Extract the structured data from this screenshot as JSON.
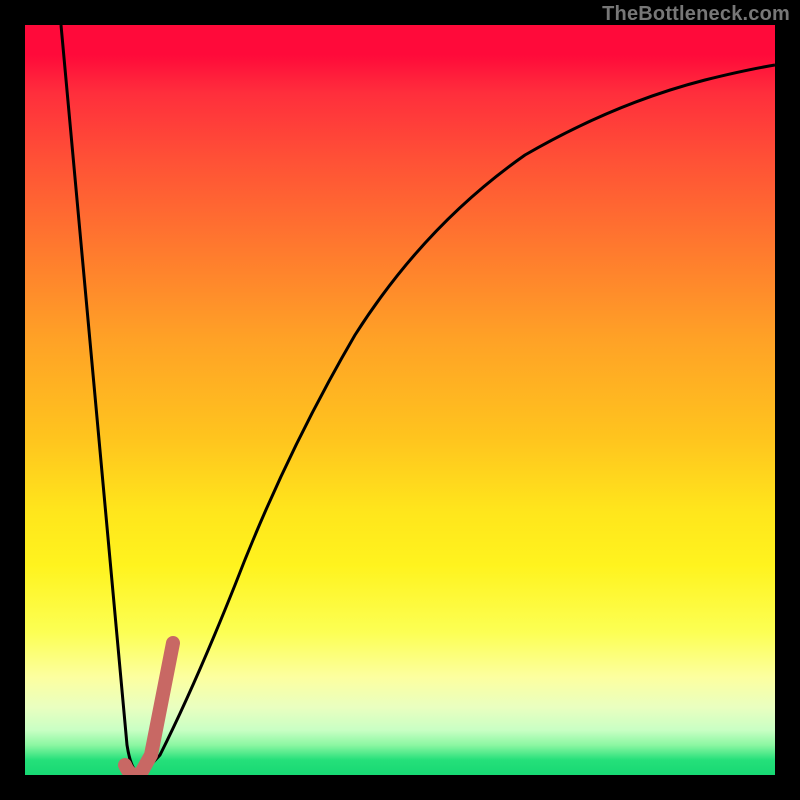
{
  "watermark": "TheBottleneck.com",
  "colors": {
    "frame": "#000000",
    "curve": "#000000",
    "overlay": "#c86864",
    "gradient_top": "#ff0a3a",
    "gradient_bottom": "#17d873"
  },
  "chart_data": {
    "type": "line",
    "title": "",
    "xlabel": "",
    "ylabel": "",
    "xlim": [
      0,
      100
    ],
    "ylim": [
      0,
      100
    ],
    "grid": false,
    "legend": false,
    "series": [
      {
        "name": "bottleneck-curve",
        "x": [
          0,
          2,
          4,
          6,
          8,
          10,
          11,
          12,
          13,
          14,
          16,
          18,
          20,
          22,
          25,
          28,
          32,
          36,
          40,
          45,
          50,
          55,
          60,
          65,
          70,
          75,
          80,
          85,
          90,
          95,
          100
        ],
        "y": [
          100,
          87,
          75,
          62,
          50,
          37,
          25,
          12,
          2,
          0,
          2,
          8,
          16,
          24,
          35,
          45,
          56,
          64,
          71,
          77,
          82,
          85.5,
          88,
          90,
          91.5,
          92.7,
          93.7,
          94.5,
          95.2,
          95.8,
          96.3
        ]
      },
      {
        "name": "highlight-segment",
        "x": [
          13,
          14,
          15,
          16,
          17,
          18,
          19
        ],
        "y": [
          1,
          0.5,
          1.5,
          4,
          9,
          15,
          22
        ]
      }
    ],
    "annotations": []
  }
}
